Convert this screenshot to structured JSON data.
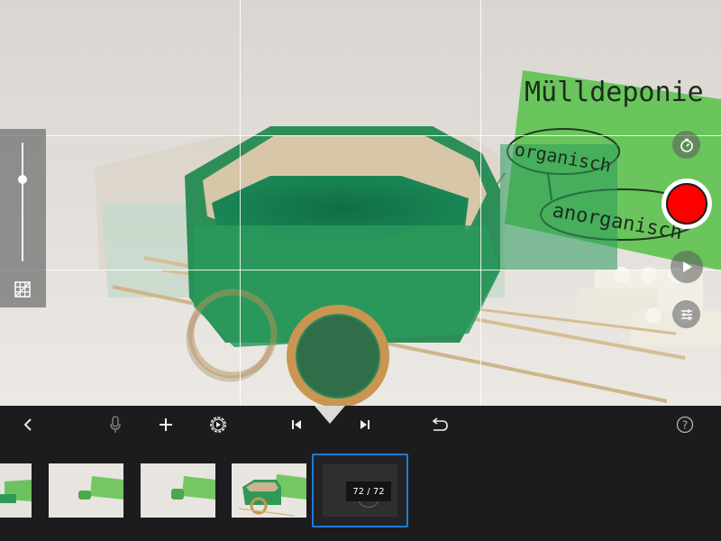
{
  "camera": {
    "sign_title": "Mülldeponie",
    "sign_label_organic": "organisch",
    "sign_label_inorganic": "anorganisch"
  },
  "toolbar": {
    "back_icon": "chevron-left-icon",
    "mic_icon": "microphone-icon",
    "add_icon": "plus-icon",
    "playback_settings_icon": "play-gear-icon",
    "first_frame_icon": "skip-to-start-icon",
    "last_frame_icon": "skip-to-end-icon",
    "undo_icon": "undo-icon",
    "help_icon": "help-icon"
  },
  "filmstrip": {
    "frame_counter": "72 / 72"
  },
  "colors": {
    "record": "#ff0000",
    "selection": "#1e7bd7",
    "overlay_green": "#2c9e5a"
  }
}
